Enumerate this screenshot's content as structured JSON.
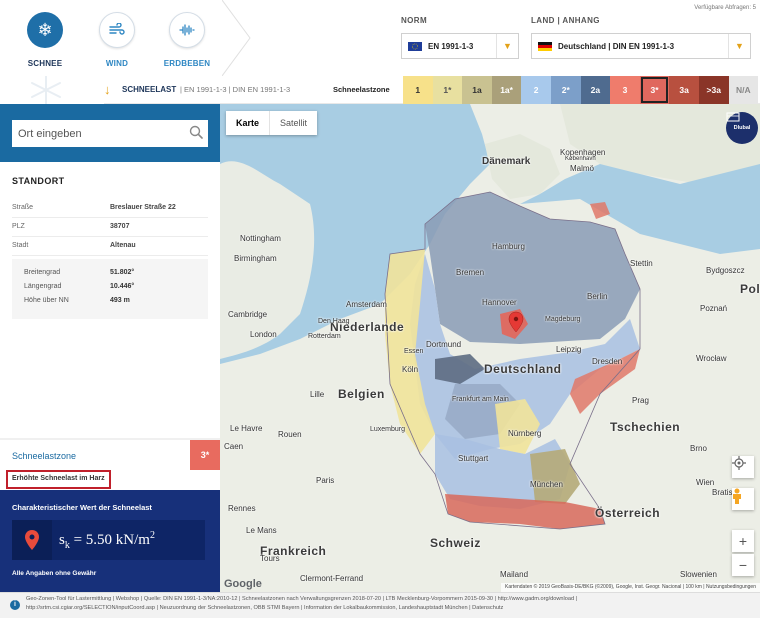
{
  "header": {
    "hazards": [
      {
        "label": "SCHNEE",
        "icon": "snowflake-icon",
        "active": true
      },
      {
        "label": "WIND",
        "icon": "wind-icon",
        "active": false
      },
      {
        "label": "ERDBEBEN",
        "icon": "seismograph-icon",
        "active": false
      }
    ],
    "norm_label": "NORM",
    "norm_value": "EN 1991-1-3",
    "country_label": "LAND | ANHANG",
    "country_value": "Deutschland | DIN EN 1991-1-3",
    "queries_text": "Verfügbare Abfragen: 5"
  },
  "zonebar": {
    "title": "SCHNEELAST",
    "norms": "| EN 1991-1-3 | DIN EN 1991-1-3",
    "zone_label": "Schneelastzone",
    "zones": [
      {
        "label": "1",
        "color": "#f7e18a",
        "text": "#333333"
      },
      {
        "label": "1*",
        "color": "#e8e0a0",
        "text": "#555555"
      },
      {
        "label": "1a",
        "color": "#c9c291",
        "text": "#333333"
      },
      {
        "label": "1a*",
        "color": "#aaa07a",
        "text": "#ffffff"
      },
      {
        "label": "2",
        "color": "#a8c9ec",
        "text": "#ffffff"
      },
      {
        "label": "2*",
        "color": "#7c9fc9",
        "text": "#ffffff"
      },
      {
        "label": "2a",
        "color": "#4f6b8f",
        "text": "#ffffff"
      },
      {
        "label": "3",
        "color": "#ef7c6c",
        "text": "#ffffff"
      },
      {
        "label": "3*",
        "color": "#e0685e",
        "text": "#ffffff"
      },
      {
        "label": "3a",
        "color": "#b8503f",
        "text": "#ffffff"
      },
      {
        "label": ">3a",
        "color": "#8a3528",
        "text": "#ffffff"
      },
      {
        "label": "N/A",
        "color": "#e6e6e6",
        "text": "#888888"
      }
    ],
    "selected_zone": "3*"
  },
  "sidebar": {
    "search_placeholder": "Ort eingeben",
    "standort_title": "STANDORT",
    "fields": [
      {
        "key": "Straße",
        "value": "Breslauer Straße 22"
      },
      {
        "key": "PLZ",
        "value": "38707"
      },
      {
        "key": "Stadt",
        "value": "Altenau"
      }
    ],
    "coords": [
      {
        "key": "Breitengrad",
        "value": "51.802°"
      },
      {
        "key": "Längengrad",
        "value": "10.446°"
      },
      {
        "key": "Höhe über NN",
        "value": "493 m"
      }
    ],
    "zone_title": "Schneelastzone",
    "zone_value": "3*",
    "harz_note": "Erhöhte Schneelast im Harz",
    "char_title": "Charakteristischer Wert der Schneelast",
    "char_symbol": "s",
    "char_subscript": "k",
    "char_value": " = 5.50 kN/m",
    "char_exponent": "2",
    "disclaimer": "Alle Angaben ohne Gewähr"
  },
  "map": {
    "tab_map": "Karte",
    "tab_satellite": "Satellit",
    "brand": "Dlubal",
    "labels": {
      "daenemark": "Dänemark",
      "kopenhagen": "Kopenhagen",
      "kobenhavn": "København",
      "malmo": "Malmö",
      "hamburg": "Hamburg",
      "bremen": "Bremen",
      "stettin": "Stettin",
      "bydgoszcz": "Bydgoszcz",
      "polen": "Polen",
      "berlin": "Berlin",
      "hannover": "Hannover",
      "magdeburg": "Magdeburg",
      "amsterdam": "Amsterdam",
      "niederlande": "Niederlande",
      "den_haag": "Den Haag",
      "rotterdam": "Rotterdam",
      "dortmund": "Dortmund",
      "essen": "Essen",
      "leipzig": "Leipzig",
      "dresden": "Dresden",
      "deutschland": "Deutschland",
      "koeln": "Köln",
      "belgien": "Belgien",
      "london": "London",
      "cambridge": "Cambridge",
      "frankfurt": "Frankfurt am Main",
      "prag": "Prag",
      "tschechien": "Tschechien",
      "luxemburg": "Luxemburg",
      "nuernberg": "Nürnberg",
      "stuttgart": "Stuttgart",
      "muenchen": "München",
      "wien": "Wien",
      "oesterreich": "Österreich",
      "paris": "Paris",
      "frankreich": "Frankreich",
      "schweiz": "Schweiz",
      "rouen": "Rouen",
      "le_havre": "Le Havre",
      "caen": "Caen",
      "rennes": "Rennes",
      "le_mans": "Le Mans",
      "tours": "Tours",
      "lille": "Lille",
      "birmingham": "Birmingham",
      "nottingham": "Nottingham",
      "slowenien": "Slowenien",
      "brno": "Brno",
      "wroclaw": "Wrocław",
      "poznan": "Poznań",
      "bratislava": "Bratislava",
      "milan": "Mailand",
      "clermont": "Clermont-Ferrand"
    },
    "attribution": "Kartendaten © 2019 GeoBasis-DE/BKG (©2009), Google, Inst. Geogr. Nacional | 100 km | Nutzungsbedingungen",
    "google": "Google"
  },
  "footer": {
    "line1": "Geo-Zonen-Tool für Lastermittlung  |  Webshop  |  Quelle: DIN EN 1991-1-3/NA:2010-12  |  Schneelastzonen nach Verwaltungsgrenzen 2018-07-20  |  LTB Mecklenburg-Vorpommern 2015-09-30  |  http://www.gadm.org/download  |",
    "line2": "http://srtm.csi.cgiar.org/SELECTION/inputCoord.asp  |  Neuzuordnung der Schneelastzonen, OBB STMI Bayern  |  Information der Lokalbaukommission, Landeshauptstadt München  |  Datenschutz"
  },
  "colors": {
    "primary": "#1a6aa1",
    "dark_navy": "#17307a",
    "accent": "#e3a21a",
    "zone_3": "#ef7c6c"
  }
}
